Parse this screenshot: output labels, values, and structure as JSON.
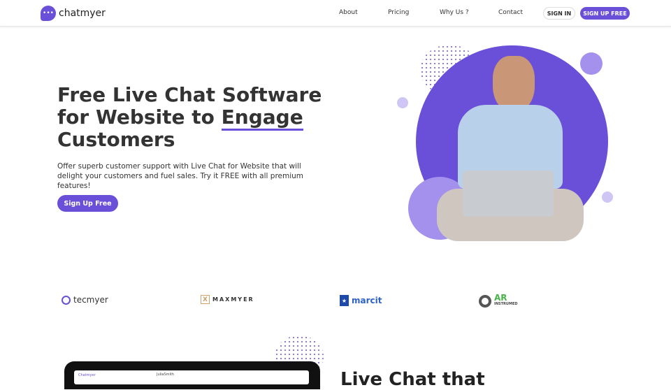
{
  "brand": {
    "name": "chatmyer",
    "accent": "#6a4fd8"
  },
  "nav": {
    "items": [
      "About",
      "Pricing",
      "Why Us ?",
      "Contact"
    ],
    "sign_in": "SIGN IN",
    "sign_up": "SIGN UP FREE"
  },
  "hero": {
    "title_pre": "Free Live Chat Software for Website to ",
    "title_highlight": "Engage",
    "title_post": " Customers",
    "subtitle": "Offer superb customer support with Live Chat for Website that will delight your customers and fuel sales. Try it FREE with all premium features!",
    "cta": "Sign Up Free"
  },
  "partners": [
    "tecmyer",
    "MAXMYER",
    "marcit",
    "AR"
  ],
  "partner_sub": "INSTRUMED",
  "section2": {
    "heading": "Live Chat that",
    "app_brand": "Chatmyer",
    "contact": "JuliaSmith"
  }
}
